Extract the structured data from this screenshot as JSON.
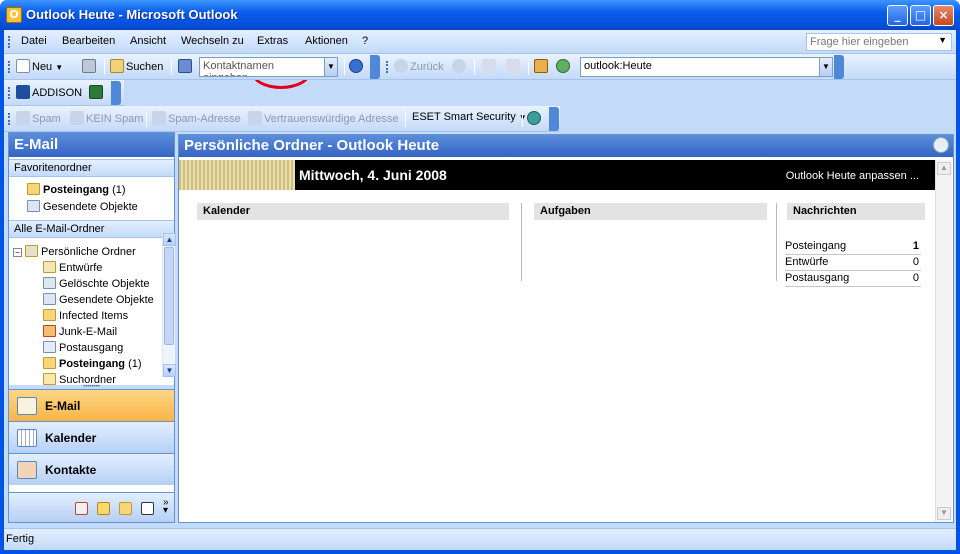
{
  "window": {
    "title": "Outlook Heute - Microsoft Outlook",
    "min": "_",
    "max": "□",
    "close": "×"
  },
  "menu": {
    "items": [
      "Datei",
      "Bearbeiten",
      "Ansicht",
      "Wechseln zu",
      "Extras",
      "Aktionen",
      "?"
    ],
    "help_placeholder": "Frage hier eingeben"
  },
  "toolbar1": {
    "new": "Neu",
    "search": "Suchen",
    "contact_placeholder": "Kontaktnamen eingeben",
    "back": "Zurück",
    "address": "outlook:Heute"
  },
  "toolbar2": {
    "addison": "ADDISON"
  },
  "toolbar3": {
    "spam": "Spam",
    "not_spam": "KEIN Spam",
    "spam_address": "Spam-Adresse",
    "trusted": "Vertrauenswürdige Adresse",
    "eset": "ESET Smart Security"
  },
  "nav": {
    "header": "E-Mail",
    "favorites_label": "Favoritenordner",
    "favorites": [
      {
        "name": "Posteingang",
        "count": "(1)"
      },
      {
        "name": "Gesendete Objekte",
        "count": ""
      }
    ],
    "all_label": "Alle E-Mail-Ordner",
    "root": "Persönliche Ordner",
    "tree": [
      {
        "name": "Entwürfe",
        "count": ""
      },
      {
        "name": "Gelöschte Objekte",
        "count": ""
      },
      {
        "name": "Gesendete Objekte",
        "count": ""
      },
      {
        "name": "Infected Items",
        "count": ""
      },
      {
        "name": "Junk-E-Mail",
        "count": ""
      },
      {
        "name": "Postausgang",
        "count": ""
      },
      {
        "name": "Posteingang",
        "count": "(1)"
      },
      {
        "name": "Suchordner",
        "count": ""
      }
    ],
    "buttons": [
      "E-Mail",
      "Kalender",
      "Kontakte"
    ]
  },
  "main": {
    "header": "Persönliche Ordner - Outlook Heute",
    "date": "Mittwoch, 4. Juni 2008",
    "customize": "Outlook Heute anpassen ...",
    "col_calendar": "Kalender",
    "col_tasks": "Aufgaben",
    "col_messages": "Nachrichten",
    "messages": [
      {
        "label": "Posteingang",
        "value": "1"
      },
      {
        "label": "Entwürfe",
        "value": "0"
      },
      {
        "label": "Postausgang",
        "value": "0"
      }
    ]
  },
  "status": {
    "text": "Fertig"
  },
  "colors": {
    "accent": "#3564c4",
    "highlight": "#e1001a",
    "active_button": "#f9b447"
  }
}
